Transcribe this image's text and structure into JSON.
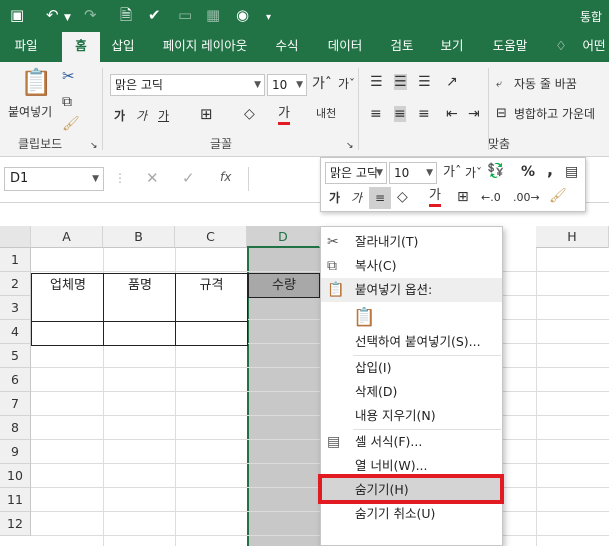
{
  "title_partial": "통합",
  "tabs": [
    "파일",
    "홈",
    "삽입",
    "페이지 레이아웃",
    "수식",
    "데이터",
    "검토",
    "보기",
    "도움말",
    "어떤"
  ],
  "groups": {
    "clipboard": "클립보드",
    "font": "글꼴",
    "align": "맞춤"
  },
  "ribbon": {
    "paste": "붙여넣기",
    "font_name": "맑은 고딕",
    "font_size": "10",
    "bold": "가",
    "italic": "가",
    "underline": "가",
    "wrap_text": "자동 줄 바꿈",
    "merge_center": "병합하고 가운데",
    "phonetic": "내천"
  },
  "formula": {
    "name_box": "D1",
    "fx": "fx"
  },
  "mini": {
    "font": "맑은 고딕",
    "size": "10",
    "percent": "%",
    "comma": ","
  },
  "columns": [
    "A",
    "B",
    "C",
    "D",
    "",
    "",
    "H"
  ],
  "rows": [
    "1",
    "2",
    "3",
    "4",
    "5",
    "6",
    "7",
    "8",
    "9",
    "10",
    "11",
    "12"
  ],
  "headers": [
    "업체명",
    "품명",
    "규격",
    "수량"
  ],
  "menu": [
    {
      "label": "잘라내기(T)",
      "icon": "scissors-icon"
    },
    {
      "label": "복사(C)",
      "icon": "copy-icon"
    },
    {
      "label": "붙여넣기 옵션:",
      "icon": "paste-icon"
    },
    {
      "label": "",
      "icon": "paste-option-icon"
    },
    {
      "label": "선택하여 붙여넣기(S)...",
      "icon": ""
    },
    {
      "label": "삽입(I)",
      "icon": ""
    },
    {
      "label": "삭제(D)",
      "icon": ""
    },
    {
      "label": "내용 지우기(N)",
      "icon": ""
    },
    {
      "label": "셀 서식(F)...",
      "icon": "format-cells-icon"
    },
    {
      "label": "열 너비(W)...",
      "icon": ""
    },
    {
      "label": "숨기기(H)",
      "icon": ""
    },
    {
      "label": "숨기기 취소(U)",
      "icon": ""
    }
  ],
  "colors": {
    "excel_green": "#217346",
    "highlight": "#e21b23",
    "selected_col": "#c8c8c8"
  }
}
